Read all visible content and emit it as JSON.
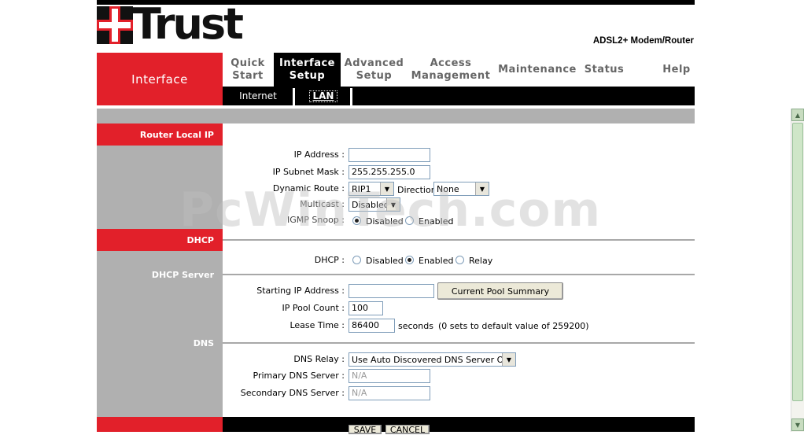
{
  "brand": {
    "logo_text": "Trust",
    "product": "ADSL2+ Modem/Router"
  },
  "nav": {
    "section_label": "Interface",
    "tabs": [
      {
        "line1": "Quick",
        "line2": "Start"
      },
      {
        "line1": "Interface",
        "line2": "Setup"
      },
      {
        "line1": "Advanced",
        "line2": "Setup"
      },
      {
        "line1": "Access",
        "line2": "Management"
      },
      {
        "line1": "Maintenance",
        "line2": ""
      },
      {
        "line1": "Status",
        "line2": ""
      },
      {
        "line1": "Help",
        "line2": ""
      }
    ],
    "subtabs": [
      "Internet",
      "LAN"
    ]
  },
  "sections": {
    "router_local_ip": "Router Local IP",
    "dhcp": "DHCP",
    "dhcp_server": "DHCP Server",
    "dns": "DNS"
  },
  "router": {
    "ip_label": "IP Address :",
    "ip_value": "",
    "mask_label": "IP Subnet Mask :",
    "mask_value": "255.255.255.0",
    "route_label": "Dynamic Route :",
    "route_value": "RIP1",
    "direction_label": "Direction",
    "direction_value": "None",
    "multicast_label": "Multicast :",
    "multicast_value": "Disabled",
    "igmp_label": "IGMP Snoop :",
    "igmp_options": [
      "Disabled",
      "Enabled"
    ],
    "igmp_selected": "Disabled"
  },
  "dhcp": {
    "label": "DHCP :",
    "options": [
      "Disabled",
      "Enabled",
      "Relay"
    ],
    "selected": "Enabled"
  },
  "dhcp_server": {
    "start_label": "Starting IP Address :",
    "start_value": "",
    "summary_button": "Current Pool Summary",
    "pool_label": "IP Pool Count :",
    "pool_value": "100",
    "lease_label": "Lease Time :",
    "lease_value": "86400",
    "lease_unit": "seconds",
    "lease_note": "(0 sets to default value of 259200)"
  },
  "dns": {
    "relay_label": "DNS Relay :",
    "relay_value": "Use Auto Discovered DNS Server Only",
    "primary_label": "Primary DNS Server :",
    "primary_value": "N/A",
    "secondary_label": "Secondary DNS Server :",
    "secondary_value": "N/A"
  },
  "buttons": {
    "save": "SAVE",
    "cancel": "CANCEL"
  },
  "watermark": "PcWinTech.com",
  "colors": {
    "accent_red": "#e2202a",
    "nav_black": "#000000",
    "section_gray": "#b0b0b0"
  }
}
